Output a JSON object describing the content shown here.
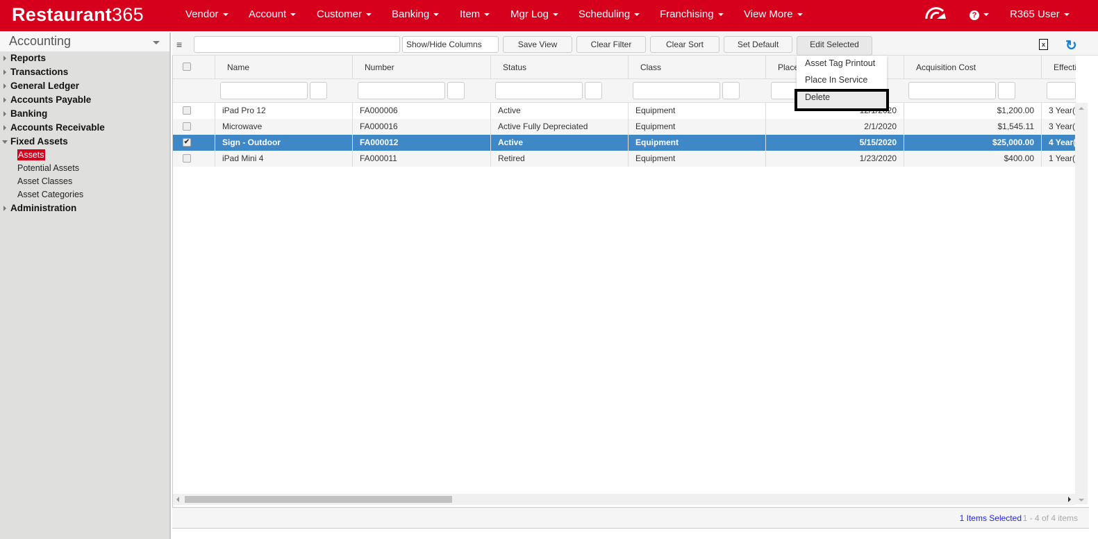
{
  "header": {
    "logo_bold": "Restaurant",
    "logo_num": "365",
    "nav": [
      "Vendor",
      "Account",
      "Customer",
      "Banking",
      "Item",
      "Mgr Log",
      "Scheduling",
      "Franchising",
      "View More"
    ],
    "user": "R365 User",
    "icons": [
      "dashboard-gauge-icon",
      "help-icon"
    ]
  },
  "sidebar": {
    "module": "Accounting",
    "items": [
      {
        "label": "Reports"
      },
      {
        "label": "Transactions"
      },
      {
        "label": "General Ledger"
      },
      {
        "label": "Accounts Payable"
      },
      {
        "label": "Banking"
      },
      {
        "label": "Accounts Receivable"
      },
      {
        "label": "Fixed Assets",
        "expanded": true
      },
      {
        "label": "Administration"
      }
    ],
    "sub_items": [
      "Assets",
      "Potential Assets",
      "Asset Classes",
      "Asset Categories"
    ],
    "active_sub": "Assets"
  },
  "toolbar": {
    "search_value": "",
    "show_hide": "Show/Hide Columns",
    "save_view": "Save View",
    "clear_filter": "Clear Filter",
    "clear_sort": "Clear Sort",
    "set_default": "Set Default",
    "edit_selected": "Edit Selected"
  },
  "edit_menu": [
    "Asset Tag Printout",
    "Place In Service",
    "Delete"
  ],
  "grid": {
    "columns": [
      "Name",
      "Number",
      "Status",
      "Class",
      "Place",
      "Acquisition Cost",
      "Effecti"
    ],
    "rows": [
      {
        "checked": false,
        "name": "iPad Pro 12",
        "number": "FA000006",
        "status": "Active",
        "class": "Equipment",
        "place": "12/1/2020",
        "cost": "$1,200.00",
        "effect": "3 Year("
      },
      {
        "checked": false,
        "name": "Microwave",
        "number": "FA000016",
        "status": "Active Fully Depreciated",
        "class": "Equipment",
        "place": "2/1/2020",
        "cost": "$1,545.11",
        "effect": "3 Year("
      },
      {
        "checked": true,
        "name": "Sign - Outdoor",
        "number": "FA000012",
        "status": "Active",
        "class": "Equipment",
        "place": "5/15/2020",
        "cost": "$25,000.00",
        "effect": "4 Year("
      },
      {
        "checked": false,
        "name": "iPad Mini 4",
        "number": "FA000011",
        "status": "Retired",
        "class": "Equipment",
        "place": "1/23/2020",
        "cost": "$400.00",
        "effect": "1 Year("
      }
    ]
  },
  "footer": {
    "selected": "1 Items Selected",
    "paging": "1 - 4 of 4 items"
  },
  "colors": {
    "brand": "#d6001c",
    "selected_row": "#3f88c8"
  }
}
